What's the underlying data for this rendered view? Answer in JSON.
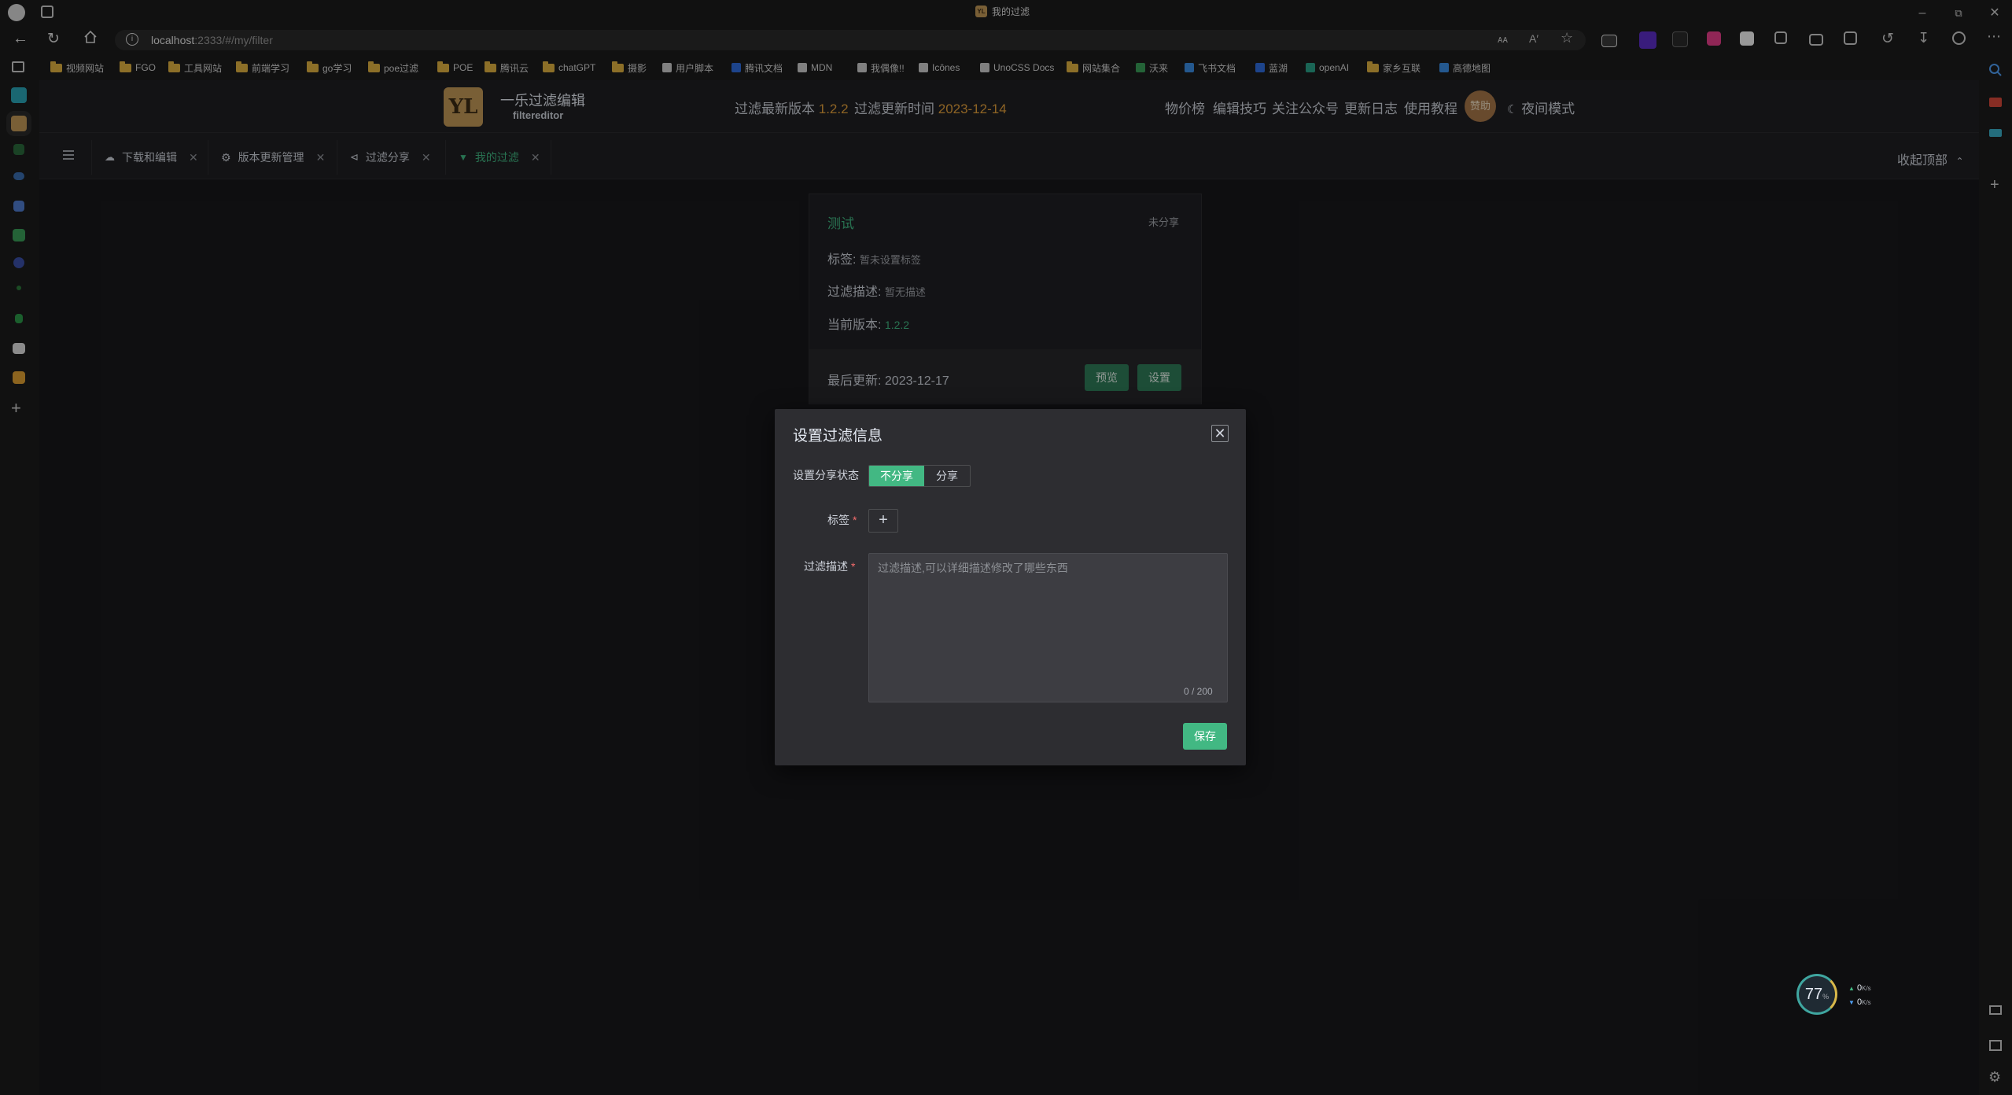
{
  "browser": {
    "tab_title": "我的过滤",
    "url_host": "localhost",
    "url_rest": ":2333/#/my/filter",
    "window_controls": [
      "minimize-icon",
      "restore-icon",
      "close-icon"
    ]
  },
  "bookmarks": [
    {
      "label": "视频网站",
      "icon": "folder-icon"
    },
    {
      "label": "FGO",
      "icon": "folder-icon"
    },
    {
      "label": "工具网站",
      "icon": "folder-icon"
    },
    {
      "label": "前端学习",
      "icon": "folder-icon"
    },
    {
      "label": "go学习",
      "icon": "folder-icon"
    },
    {
      "label": "poe过滤",
      "icon": "folder-icon"
    },
    {
      "label": "POE",
      "icon": "folder-icon"
    },
    {
      "label": "腾讯云",
      "icon": "folder-icon"
    },
    {
      "label": "chatGPT",
      "icon": "folder-icon"
    },
    {
      "label": "摄影",
      "icon": "folder-icon"
    },
    {
      "label": "用户脚本",
      "icon": "script-icon"
    },
    {
      "label": "腾讯文档",
      "icon": "doc-icon"
    },
    {
      "label": "MDN",
      "icon": "mdn-icon"
    },
    {
      "label": "我偶像!!",
      "icon": "link-icon"
    },
    {
      "label": "Icônes",
      "icon": "icones-icon"
    },
    {
      "label": "UnoCSS Docs",
      "icon": "unocss-icon"
    },
    {
      "label": "网站集合",
      "icon": "folder-icon"
    },
    {
      "label": "沃来",
      "icon": "check-icon"
    },
    {
      "label": "飞书文档",
      "icon": "feishu-icon"
    },
    {
      "label": "蓝湖",
      "icon": "lanhu-icon"
    },
    {
      "label": "openAI",
      "icon": "openai-icon"
    },
    {
      "label": "家乡互联",
      "icon": "folder-icon"
    },
    {
      "label": "高德地图",
      "icon": "map-icon"
    }
  ],
  "app": {
    "logo_text": "YL",
    "brand_name": "一乐过滤编辑",
    "brand_sub": "filtereditor",
    "latest_version_label": "过滤最新版本",
    "latest_version": "1.2.2",
    "update_time_label": "过滤更新时间",
    "update_time": "2023-12-14",
    "nav": [
      "物价榜",
      "编辑技巧",
      "关注公众号",
      "更新日志",
      "使用教程"
    ],
    "avatar_text": "赞助",
    "night_mode": "夜间模式"
  },
  "tabs": [
    {
      "label": "下载和编辑",
      "icon": "cloud-icon",
      "active": false
    },
    {
      "label": "版本更新管理",
      "icon": "settings-icon",
      "active": false
    },
    {
      "label": "过滤分享",
      "icon": "share-icon",
      "active": false
    },
    {
      "label": "我的过滤",
      "icon": "filter-icon",
      "active": true
    }
  ],
  "collapse_top": "收起顶部",
  "card": {
    "title": "测试",
    "share_status": "未分享",
    "tag_label": "标签:",
    "tag_value": "暂未设置标签",
    "desc_label": "过滤描述:",
    "desc_value": "暂无描述",
    "version_label": "当前版本:",
    "version_value": "1.2.2",
    "last_update_label": "最后更新:",
    "last_update_value": "2023-12-17",
    "preview_btn": "预览",
    "settings_btn": "设置"
  },
  "modal": {
    "title": "设置过滤信息",
    "share_status_label": "设置分享状态",
    "share_options": [
      "不分享",
      "分享"
    ],
    "share_selected": "不分享",
    "tag_label": "标签",
    "desc_label": "过滤描述",
    "desc_value": "",
    "desc_placeholder": "过滤描述,可以详细描述修改了哪些东西",
    "desc_count": "0 / 200",
    "save_btn": "保存"
  },
  "net_widget": {
    "percent": "77",
    "percent_unit": "%",
    "up_speed": "0",
    "down_speed": "0",
    "speed_unit": "K/s"
  },
  "colors": {
    "accent": "#42b883",
    "highlight": "#e6a23c",
    "required": "#f56c6c",
    "background": "#18181b"
  }
}
